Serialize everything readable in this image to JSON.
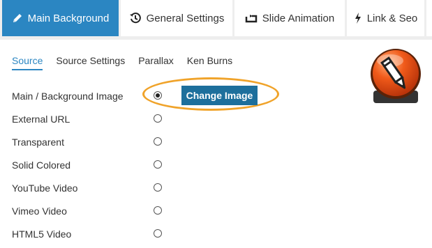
{
  "tabs": [
    {
      "label": "Main Background",
      "icon": "pencil-icon",
      "active": true
    },
    {
      "label": "General Settings",
      "icon": "history-icon",
      "active": false
    },
    {
      "label": "Slide Animation",
      "icon": "loop-icon",
      "active": false
    },
    {
      "label": "Link & Seo",
      "icon": "bolt-icon",
      "active": false
    }
  ],
  "subtabs": [
    {
      "label": "Source",
      "active": true
    },
    {
      "label": "Source Settings",
      "active": false
    },
    {
      "label": "Parallax",
      "active": false
    },
    {
      "label": "Ken Burns",
      "active": false
    }
  ],
  "sources": [
    {
      "label": "Main / Background Image",
      "checked": true
    },
    {
      "label": "External URL",
      "checked": false
    },
    {
      "label": "Transparent",
      "checked": false
    },
    {
      "label": "Solid Colored",
      "checked": false
    },
    {
      "label": "YouTube Video",
      "checked": false
    },
    {
      "label": "Vimeo Video",
      "checked": false
    },
    {
      "label": "HTML5 Video",
      "checked": false
    }
  ],
  "change_image_label": "Change Image",
  "colors": {
    "accent": "#2b86c2",
    "button": "#1d6f9c",
    "highlight": "#f0a32a",
    "logo": "#f05a1a"
  },
  "logo_icon": "pencil-logo-icon"
}
